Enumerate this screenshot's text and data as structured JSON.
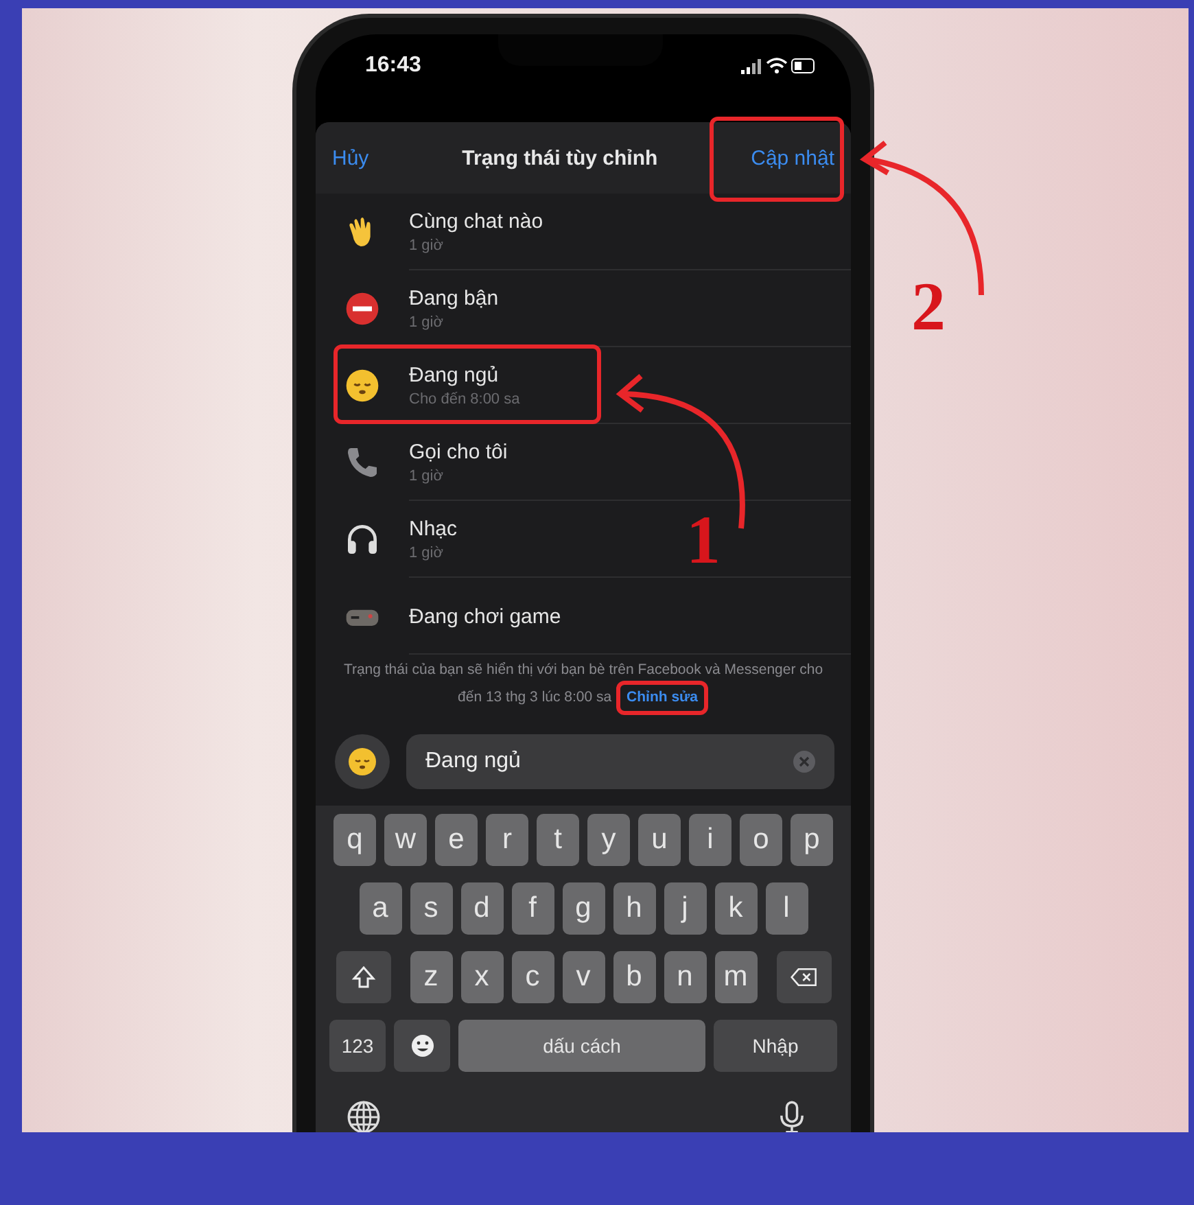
{
  "status_bar": {
    "time": "16:43"
  },
  "header": {
    "cancel": "Hủy",
    "title": "Trạng thái tùy chỉnh",
    "update": "Cập nhật"
  },
  "statuses": [
    {
      "kind": "wave",
      "title": "Cùng chat nào",
      "duration": "1 giờ"
    },
    {
      "kind": "busy",
      "title": "Đang bận",
      "duration": "1 giờ"
    },
    {
      "kind": "sleep",
      "title": "Đang ngủ",
      "duration": "Cho đến 8:00 sa"
    },
    {
      "kind": "call",
      "title": "Gọi cho tôi",
      "duration": "1 giờ"
    },
    {
      "kind": "music",
      "title": "Nhạc",
      "duration": "1 giờ"
    },
    {
      "kind": "game",
      "title": "Đang chơi game"
    }
  ],
  "footnote": {
    "text": "Trạng thái của bạn sẽ hiển thị với bạn bè trên Facebook và Messenger cho đến 13 thg 3 lúc 8:00 sa",
    "link": "Chỉnh sửa"
  },
  "input": {
    "value": "Đang ngủ"
  },
  "keyboard": {
    "rows": [
      [
        "q",
        "w",
        "e",
        "r",
        "t",
        "y",
        "u",
        "i",
        "o",
        "p"
      ],
      [
        "a",
        "s",
        "d",
        "f",
        "g",
        "h",
        "j",
        "k",
        "l"
      ],
      [
        "z",
        "x",
        "c",
        "v",
        "b",
        "n",
        "m"
      ]
    ],
    "numbers": "123",
    "space": "dấu cách",
    "return": "Nhập"
  },
  "annotations": [
    {
      "label": "1"
    },
    {
      "label": "2"
    }
  ]
}
